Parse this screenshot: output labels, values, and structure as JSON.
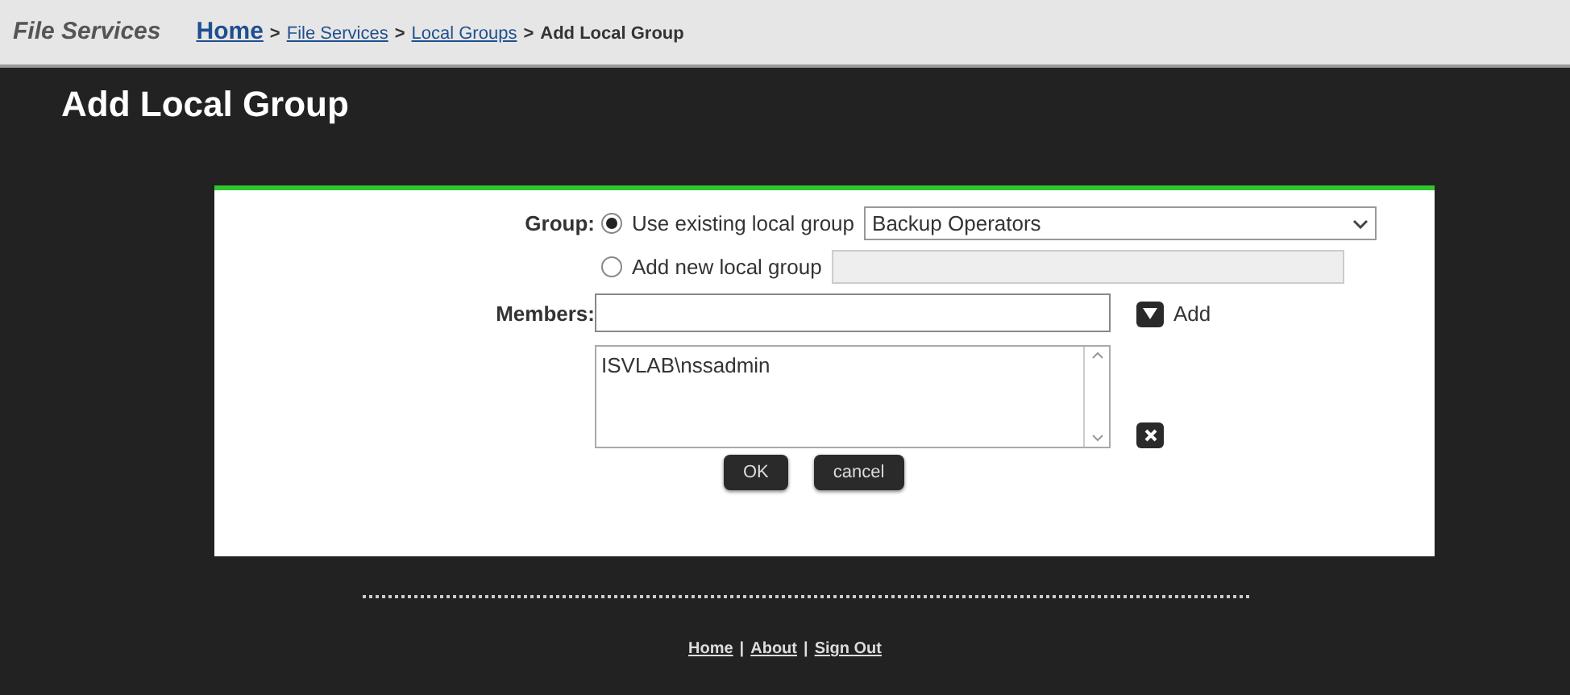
{
  "header": {
    "section": "File Services",
    "breadcrumb": [
      {
        "label": "Home",
        "kind": "home"
      },
      {
        "label": "File Services",
        "kind": "link"
      },
      {
        "label": "Local Groups",
        "kind": "link"
      },
      {
        "label": "Add Local Group",
        "kind": "current"
      }
    ],
    "separator": ">"
  },
  "page_title": "Add Local Group",
  "form": {
    "group_label": "Group:",
    "options": [
      {
        "label": "Use existing local group",
        "selected": true,
        "kind": "select",
        "value": "Backup Operators"
      },
      {
        "label": "Add new local group",
        "selected": false,
        "kind": "text"
      }
    ],
    "members_label": "Members:",
    "add_label": "Add",
    "members": [
      "ISVLAB\\nssadmin"
    ],
    "buttons": [
      "OK",
      "cancel"
    ]
  },
  "footer": {
    "links": [
      "Home",
      "About",
      "Sign Out"
    ],
    "separator": "|"
  }
}
